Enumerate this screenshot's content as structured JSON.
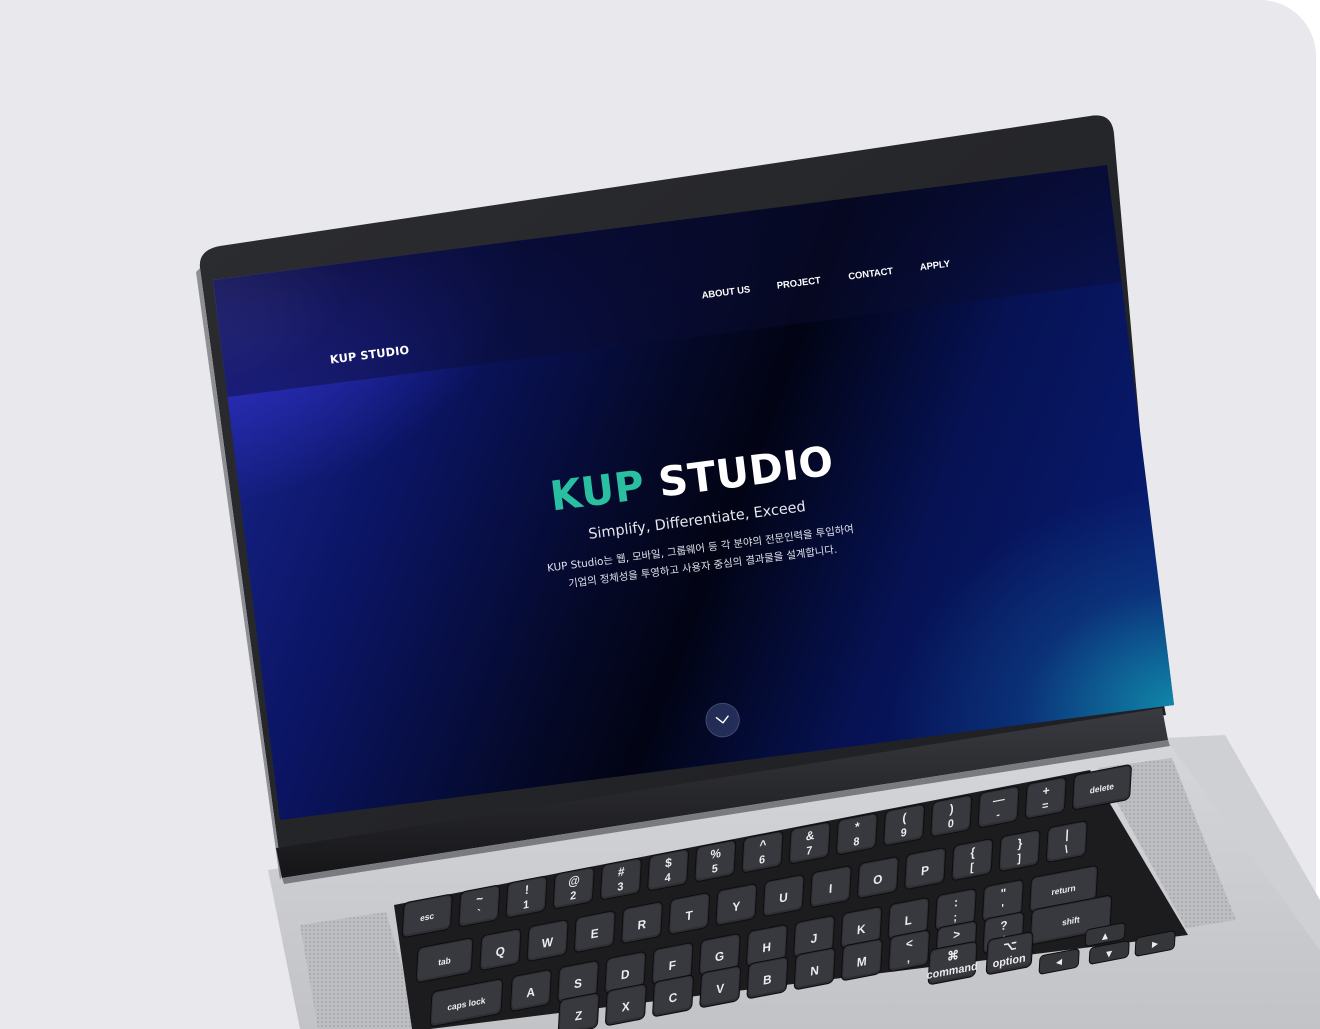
{
  "site": {
    "logo": "KUP STUDIO",
    "nav": [
      {
        "label": "ABOUT US"
      },
      {
        "label": "PROJECT"
      },
      {
        "label": "CONTACT"
      },
      {
        "label": "APPLY"
      }
    ]
  },
  "hero": {
    "title_accent": "KUP",
    "title_rest": "STUDIO",
    "tagline": "Simplify, Differentiate, Exceed",
    "description_line1": "KUP Studio는 웹, 모바일, 그룹웨어 등 각 분야의 전문인력을 투입하여",
    "description_line2": "기업의 정체성을 투영하고 사용자 중심의 결과물을 설계합니다."
  },
  "scroll_button": {
    "icon": "chevron-down-icon"
  },
  "keyboard": {
    "row_fn": [
      "esc",
      "~",
      "!",
      "@",
      "#",
      "$",
      "%",
      "^",
      "&",
      "*",
      "(",
      ")",
      "—",
      "+",
      "delete"
    ],
    "row_fn_sub": [
      "",
      "`",
      "1",
      "2",
      "3",
      "4",
      "5",
      "6",
      "7",
      "8",
      "9",
      "0",
      "-",
      "=",
      ""
    ],
    "row_q": [
      "tab",
      "Q",
      "W",
      "E",
      "R",
      "T",
      "Y",
      "U",
      "I",
      "O",
      "P",
      "{",
      "}",
      "|"
    ],
    "row_q_sub": [
      "",
      "",
      "",
      "",
      "",
      "",
      "",
      "",
      "",
      "",
      "",
      "[",
      "]",
      "\\"
    ],
    "row_a": [
      "caps lock",
      "A",
      "S",
      "D",
      "F",
      "G",
      "H",
      "J",
      "K",
      "L",
      ":",
      "\"",
      "return"
    ],
    "row_a_sub": [
      "",
      "",
      "",
      "",
      "",
      "",
      "",
      "",
      "",
      "",
      ";",
      "'",
      ""
    ],
    "row_z": [
      "Z",
      "X",
      "C",
      "V",
      "B",
      "N",
      "M",
      "<",
      ">",
      "?",
      "shift"
    ],
    "row_z_sub": [
      "",
      "",
      "",
      "",
      "",
      "",
      "",
      ",",
      ".",
      "/",
      ""
    ],
    "row_mod": [
      "⌘",
      "command",
      "⌥",
      "option"
    ]
  },
  "colors": {
    "accent": "#2bbfa2",
    "backdrop": "#e9e9ed",
    "laptop_body": "#c9c9cc"
  }
}
